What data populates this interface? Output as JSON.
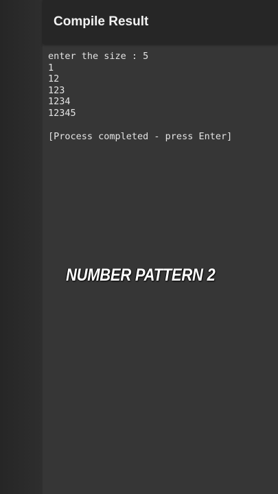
{
  "app": {
    "title": "Compile Result"
  },
  "console": {
    "lines": [
      "enter the size : 5",
      "1",
      "12",
      "123",
      "1234",
      "12345"
    ],
    "footer": "[Process completed - press Enter]"
  },
  "overlay": {
    "caption": "NUMBER PATTERN 2"
  }
}
